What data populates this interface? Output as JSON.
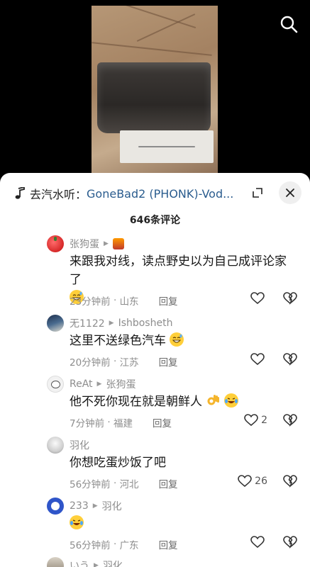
{
  "music": {
    "prefix": "去汽水听：",
    "title": "GoneBad2 (PHONK)-Vod..."
  },
  "comments_count": "646条评论",
  "comments": [
    {
      "user": "张狗蛋",
      "badge": "flame-badge",
      "text": "来跟我对线，读点野史以为自己成评论家了",
      "emojis": [
        "grin-sweat"
      ],
      "time": "23分钟前",
      "location": "山东",
      "reply": "回复",
      "likes": ""
    },
    {
      "user": "无1122",
      "reply_to": "Ishbosheth",
      "text": "这里不送绿色汽车",
      "emojis": [
        "grin-sweat"
      ],
      "time": "20分钟前",
      "location": "江苏",
      "reply": "回复",
      "likes": ""
    },
    {
      "user": "ReAt",
      "reply_to": "张狗蛋",
      "text": "他不死你现在就是朝鲜人",
      "emojis": [
        "ok-hand",
        "tears-of-joy"
      ],
      "time": "7分钟前",
      "location": "福建",
      "reply": "回复",
      "likes": "2"
    },
    {
      "user": "羽化",
      "text": "你想吃蛋炒饭了吧",
      "time": "56分钟前",
      "location": "河北",
      "reply": "回复",
      "likes": "26"
    },
    {
      "user": "233",
      "reply_to": "羽化",
      "text": "",
      "emojis": [
        "tears-of-joy"
      ],
      "time": "56分钟前",
      "location": "广东",
      "reply": "回复",
      "likes": ""
    },
    {
      "user": "いう",
      "reply_to": "羽化",
      "text": ""
    }
  ],
  "icons": {
    "search": "search-icon",
    "music": "music-note-icon",
    "pip": "picture-in-picture-icon",
    "close": "close-icon",
    "like": "heart-outline-icon",
    "dislike": "broken-heart-icon"
  },
  "colors": {
    "link": "#2a5c8e",
    "meta": "#8d8d8d",
    "sheet_bg": "#ffffff"
  }
}
